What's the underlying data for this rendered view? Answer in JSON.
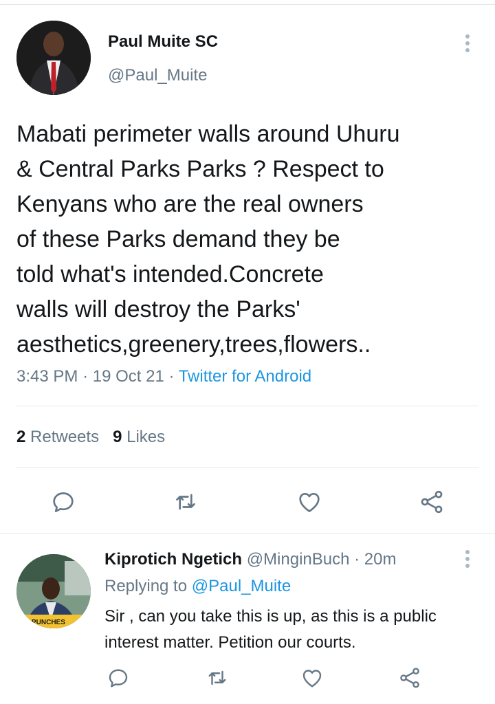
{
  "tweet": {
    "author_name": "Paul Muite SC",
    "author_handle": "@Paul_Muite",
    "text_lines": [
      "Mabati perimeter walls around Uhuru",
      "& Central Parks Parks ? Respect to",
      "Kenyans who are the real owners",
      "of these Parks demand they be",
      "told what's intended.Concrete",
      "walls will destroy the Parks'",
      "aesthetics,greenery,trees,flowers.."
    ],
    "time": "3:43 PM",
    "date": "19 Oct 21",
    "source": "Twitter for Android",
    "separator": "·",
    "retweets_count": "2",
    "retweets_label": "Retweets",
    "likes_count": "9",
    "likes_label": "Likes"
  },
  "reply": {
    "author_name": "Kiprotich Ngetich",
    "author_handle": "@MinginBuch",
    "separator": "·",
    "time_ago": "20m",
    "replying_prefix": "Replying to",
    "replying_to": "@Paul_Muite",
    "text_lines": [
      "Sir , can you take this is up, as this is a public",
      "interest matter. Petition our courts."
    ],
    "avatar_caption": "PUNCHES"
  },
  "icons": {
    "reply": "reply-icon",
    "retweet": "retweet-icon",
    "like": "heart-icon",
    "share": "share-icon",
    "more": "more-vertical-icon"
  },
  "colors": {
    "link": "#1b95e0",
    "secondary_text": "#657786",
    "primary_text": "#14171a",
    "divider": "#e1e8ed",
    "icon": "#657786"
  }
}
